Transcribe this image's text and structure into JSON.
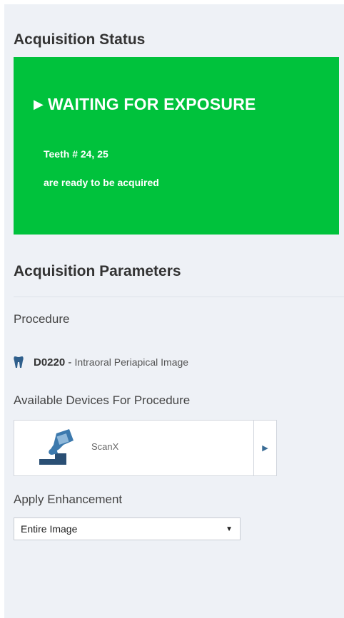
{
  "acquisition_status": {
    "title": "Acquisition Status",
    "headline": "WAITING FOR EXPOSURE",
    "teeth_line": "Teeth # 24, 25",
    "ready_line": "are ready to be acquired",
    "box_color": "#00c23c"
  },
  "acquisition_parameters": {
    "title": "Acquisition Parameters",
    "procedure_label": "Procedure",
    "procedure": {
      "icon": "tooth-icon",
      "code": "D0220",
      "separator": " - ",
      "description": "Intraoral Periapical Image"
    },
    "devices_label": "Available Devices For Procedure",
    "device": {
      "icon": "scanner-icon",
      "name": "ScanX"
    },
    "enhancement_label": "Apply Enhancement",
    "enhancement_value": "Entire Image"
  }
}
